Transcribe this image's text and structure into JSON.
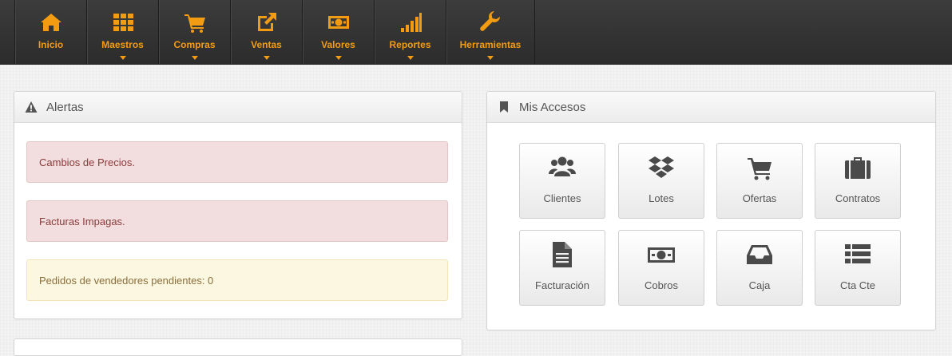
{
  "nav": [
    {
      "label": "Inicio",
      "icon": "home-icon",
      "dropdown": false
    },
    {
      "label": "Maestros",
      "icon": "grid-icon",
      "dropdown": true
    },
    {
      "label": "Compras",
      "icon": "cart-icon",
      "dropdown": true
    },
    {
      "label": "Ventas",
      "icon": "external-link-icon",
      "dropdown": true
    },
    {
      "label": "Valores",
      "icon": "banknote-icon",
      "dropdown": true
    },
    {
      "label": "Reportes",
      "icon": "signal-icon",
      "dropdown": true
    },
    {
      "label": "Herramientas",
      "icon": "wrench-icon",
      "dropdown": true
    }
  ],
  "alerts_panel": {
    "title": "Alertas",
    "icon": "warning-icon",
    "items": [
      {
        "text": "Cambios de Precios.",
        "type": "danger"
      },
      {
        "text": "Facturas Impagas.",
        "type": "danger"
      },
      {
        "text": "Pedidos de vendedores pendientes: 0",
        "type": "warning"
      }
    ]
  },
  "access_panel": {
    "title": "Mis Accesos",
    "icon": "bookmark-icon",
    "tiles": [
      {
        "label": "Clientes",
        "icon": "users-icon"
      },
      {
        "label": "Lotes",
        "icon": "dropbox-icon"
      },
      {
        "label": "Ofertas",
        "icon": "cart-icon"
      },
      {
        "label": "Contratos",
        "icon": "briefcase-icon"
      },
      {
        "label": "Facturación",
        "icon": "file-text-icon"
      },
      {
        "label": "Cobros",
        "icon": "banknote-icon"
      },
      {
        "label": "Caja",
        "icon": "inbox-icon"
      },
      {
        "label": "Cta Cte",
        "icon": "list-icon"
      }
    ]
  },
  "colors": {
    "accent": "#f39c12",
    "navbar": "#333333",
    "danger_bg": "#f2dede",
    "warning_bg": "#fcf7e0"
  }
}
